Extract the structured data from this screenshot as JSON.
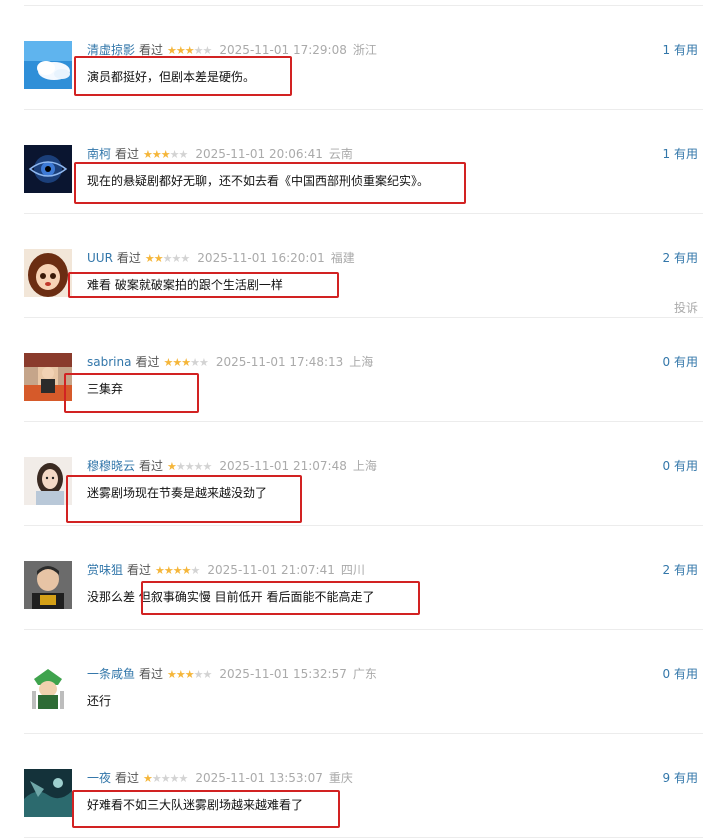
{
  "watched_label": "看过",
  "useful_suffix": "有用",
  "colors": {
    "username": "#3377aa",
    "star_on": "#f5b63a",
    "star_off": "#d3d3d3",
    "highlight_border": "#d22222"
  },
  "reviews": [
    {
      "user": "清虚掠影",
      "rating": 3,
      "time": "2025-11-01 17:29:08",
      "location": "浙江",
      "useful_count": "1",
      "content": "演员都挺好，但剧本差是硬伤。",
      "avatar": "sky-cloud-avatar"
    },
    {
      "user": "南柯",
      "rating": 3,
      "time": "2025-11-01 20:06:41",
      "location": "云南",
      "useful_count": "1",
      "content": "现在的悬疑剧都好无聊，还不如去看《中国西部刑侦重案纪实》。",
      "avatar": "eye-avatar"
    },
    {
      "user": "UUR",
      "rating": 2,
      "time": "2025-11-01 16:20:01",
      "location": "福建",
      "useful_count": "2",
      "content": "难看 破案就破案拍的跟个生活剧一样",
      "avatar": "cartoon-girl-avatar",
      "report_label": "投诉"
    },
    {
      "user": "sabrina",
      "rating": 3,
      "time": "2025-11-01 17:48:13",
      "location": "上海",
      "useful_count": "0",
      "content": "三集弃",
      "avatar": "photo-person-avatar"
    },
    {
      "user": "穆穆晓云",
      "rating": 1,
      "time": "2025-11-01 21:07:48",
      "location": "上海",
      "useful_count": "0",
      "content": "迷雾剧场现在节奏是越来越没劲了",
      "avatar": "woman-portrait-avatar"
    },
    {
      "user": "赏味狙",
      "rating": 4,
      "time": "2025-11-01 21:07:41",
      "location": "四川",
      "useful_count": "2",
      "content": "没那么差 但叙事确实慢 目前低开 看后面能不能高走了",
      "avatar": "man-portrait-avatar"
    },
    {
      "user": "一条咸鱼",
      "rating": 3,
      "time": "2025-11-01 15:32:57",
      "location": "广东",
      "useful_count": "0",
      "content": "还行",
      "avatar": "green-character-avatar"
    },
    {
      "user": "一夜",
      "rating": 1,
      "time": "2025-11-01 13:53:07",
      "location": "重庆",
      "useful_count": "9",
      "content": "好难看不如三大队迷雾剧场越来越难看了",
      "avatar": "dark-scene-avatar"
    }
  ]
}
